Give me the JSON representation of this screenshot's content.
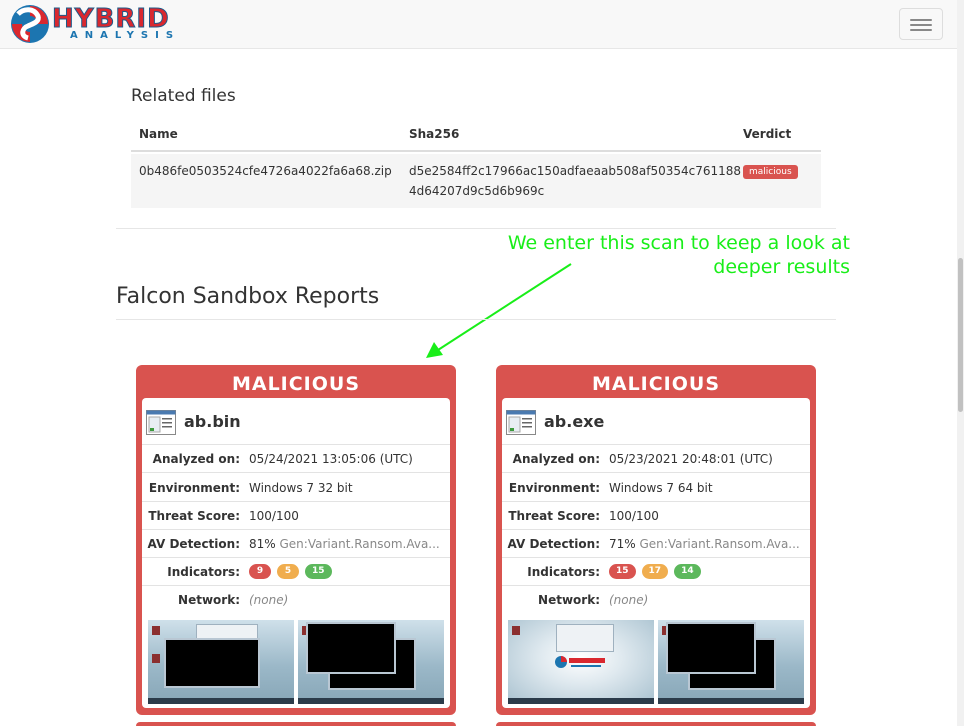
{
  "navbar": {
    "logo_text": "HYBRID",
    "logo_subtext": "ANALYSIS"
  },
  "related_files": {
    "title": "Related files",
    "columns": [
      "Name",
      "Sha256",
      "Verdict"
    ],
    "rows": [
      {
        "name": "0b486fe0503524cfe4726a4022fa6a68.zip",
        "sha256_line1": "d5e2584ff2c17966ac150adfaeaab508af50354c761188",
        "sha256_line2": "4d64207d9c5d6b969c",
        "verdict": "malicious"
      }
    ]
  },
  "annotation": {
    "line1": "We enter this scan to keep a look at",
    "line2": "deeper results",
    "color": "#19ee19"
  },
  "reports": {
    "title": "Falcon Sandbox Reports",
    "cards": [
      {
        "verdict": "MALICIOUS",
        "file_name": "ab.bin",
        "analyzed_on_label": "Analyzed on:",
        "analyzed_on": "05/24/2021 13:05:06 (UTC)",
        "environment_label": "Environment:",
        "environment": "Windows 7 32 bit",
        "threat_score_label": "Threat Score:",
        "threat_score": "100/100",
        "av_detection_label": "AV Detection:",
        "av_detection_percent": "81%",
        "av_detection_name": "Gen:Variant.Ransom.Ava...",
        "indicators_label": "Indicators:",
        "indicators": {
          "malicious": "9",
          "suspicious": "5",
          "informative": "15"
        },
        "network_label": "Network:",
        "network": "(none)"
      },
      {
        "verdict": "MALICIOUS",
        "file_name": "ab.exe",
        "analyzed_on_label": "Analyzed on:",
        "analyzed_on": "05/23/2021 20:48:01 (UTC)",
        "environment_label": "Environment:",
        "environment": "Windows 7 64 bit",
        "threat_score_label": "Threat Score:",
        "threat_score": "100/100",
        "av_detection_label": "AV Detection:",
        "av_detection_percent": "71%",
        "av_detection_name": "Gen:Variant.Ransom.Ava...",
        "indicators_label": "Indicators:",
        "indicators": {
          "malicious": "15",
          "suspicious": "17",
          "informative": "14"
        },
        "network_label": "Network:",
        "network": "(none)"
      }
    ]
  },
  "colors": {
    "malicious": "#d9534f",
    "suspicious": "#f0ad4e",
    "informative": "#5cb85c"
  }
}
